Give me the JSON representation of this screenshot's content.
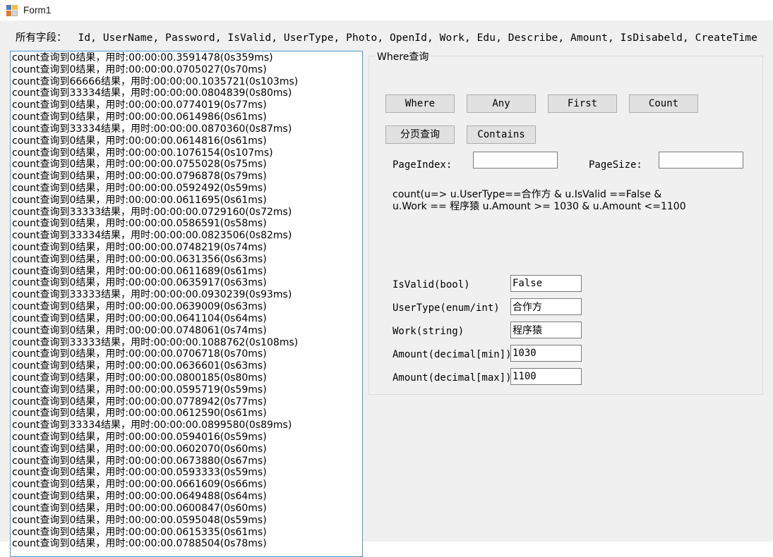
{
  "window": {
    "title": "Form1",
    "icon": "winforms-designer-icon"
  },
  "fields_row": {
    "label": "所有字段：",
    "value": "Id, UserName, Password, IsValid, UserType, Photo, OpenId, Work, Edu, Describe, Amount, IsDisabeld, CreateTime"
  },
  "log": {
    "lines": [
      "count查询到0结果，用时:00:00:00.3591478(0s359ms)",
      "count查询到0结果，用时:00:00:00.0705027(0s70ms)",
      "count查询到66666结果，用时:00:00:00.1035721(0s103ms)",
      "count查询到33334结果，用时:00:00:00.0804839(0s80ms)",
      "count查询到0结果，用时:00:00:00.0774019(0s77ms)",
      "count查询到0结果，用时:00:00:00.0614986(0s61ms)",
      "count查询到33334结果，用时:00:00:00.0870360(0s87ms)",
      "count查询到0结果，用时:00:00:00.0614816(0s61ms)",
      "count查询到0结果，用时:00:00:00.1076154(0s107ms)",
      "count查询到0结果，用时:00:00:00.0755028(0s75ms)",
      "count查询到0结果，用时:00:00:00.0796878(0s79ms)",
      "count查询到0结果，用时:00:00:00.0592492(0s59ms)",
      "count查询到0结果，用时:00:00:00.0611695(0s61ms)",
      "count查询到33333结果，用时:00:00:00.0729160(0s72ms)",
      "count查询到0结果，用时:00:00:00.0586591(0s58ms)",
      "count查询到33334结果，用时:00:00:00.0823506(0s82ms)",
      "count查询到0结果，用时:00:00:00.0748219(0s74ms)",
      "count查询到0结果，用时:00:00:00.0631356(0s63ms)",
      "count查询到0结果，用时:00:00:00.0611689(0s61ms)",
      "count查询到0结果，用时:00:00:00.0635917(0s63ms)",
      "count查询到33333结果，用时:00:00:00.0930239(0s93ms)",
      "count查询到0结果，用时:00:00:00.0639009(0s63ms)",
      "count查询到0结果，用时:00:00:00.0641104(0s64ms)",
      "count查询到0结果，用时:00:00:00.0748061(0s74ms)",
      "count查询到33333结果，用时:00:00:00.1088762(0s108ms)",
      "count查询到0结果，用时:00:00:00.0706718(0s70ms)",
      "count查询到0结果，用时:00:00:00.0636601(0s63ms)",
      "count查询到0结果，用时:00:00:00.0800185(0s80ms)",
      "count查询到0结果，用时:00:00:00.0595719(0s59ms)",
      "count查询到0结果，用时:00:00:00.0778942(0s77ms)",
      "count查询到0结果，用时:00:00:00.0612590(0s61ms)",
      "count查询到33334结果，用时:00:00:00.0899580(0s89ms)",
      "count查询到0结果，用时:00:00:00.0594016(0s59ms)",
      "count查询到0结果，用时:00:00:00.0602070(0s60ms)",
      "count查询到0结果，用时:00:00:00.0673880(0s67ms)",
      "count查询到0结果，用时:00:00:00.0593333(0s59ms)",
      "count查询到0结果，用时:00:00:00.0661609(0s66ms)",
      "count查询到0结果，用时:00:00:00.0649488(0s64ms)",
      "count查询到0结果，用时:00:00:00.0600847(0s60ms)",
      "count查询到0结果，用时:00:00:00.0595048(0s59ms)",
      "count查询到0结果，用时:00:00:00.0615335(0s61ms)",
      "count查询到0结果，用时:00:00:00.0788504(0s78ms)"
    ]
  },
  "where_group": {
    "title": "Where查询",
    "buttons": {
      "where": "Where",
      "any": "Any",
      "first": "First",
      "count": "Count",
      "paging": "分页查询",
      "contains": "Contains"
    },
    "paging": {
      "pageindex_label": "PageIndex:",
      "pageindex_value": "",
      "pagesize_label": "PageSize:",
      "pagesize_value": ""
    },
    "expression": "count(u=> u.UserType==合作方 & u.IsValid ==False &\nu.Work == 程序猿 u.Amount >= 1030 & u.Amount <=1100",
    "criteria": [
      {
        "label": "IsValid(bool)",
        "value": "False"
      },
      {
        "label": "UserType(enum/int)",
        "value": "合作方"
      },
      {
        "label": "Work(string)",
        "value": "程序猿"
      },
      {
        "label": "Amount(decimal[min])",
        "value": "1030"
      },
      {
        "label": "Amount(decimal[max])",
        "value": "1100"
      }
    ]
  },
  "colors": {
    "listbox_focus_border": "#4a9ad4",
    "form_background": "#f0f0f0",
    "button_face": "#e1e1e1",
    "input_background": "#ffffff"
  }
}
